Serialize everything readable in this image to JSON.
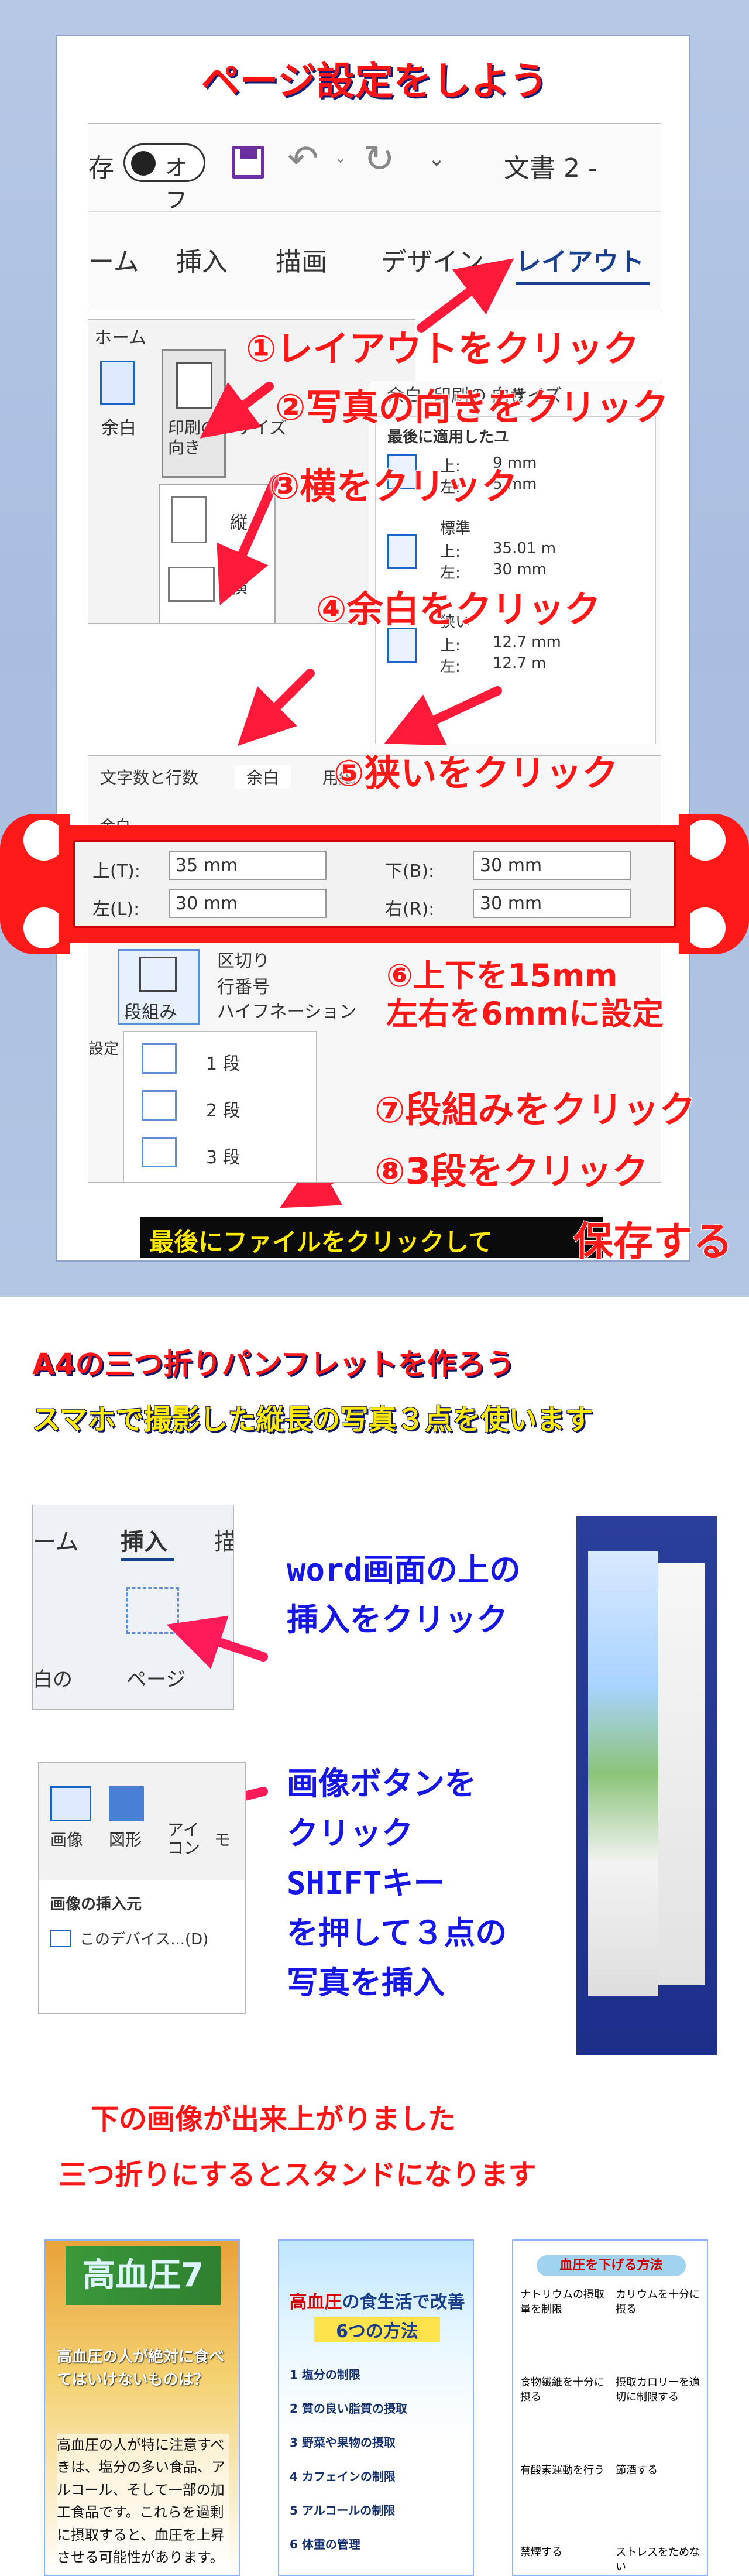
{
  "part1": {
    "title": "ページ設定をしよう",
    "toolbar": {
      "autosave_label": "存",
      "toggle_label": "オフ",
      "doc_name": "文書 2 -",
      "tabs": [
        "ーム",
        "挿入",
        "描画",
        "デザイン",
        "レイアウト"
      ]
    },
    "ribbon": {
      "home": "ホーム",
      "margins": "余白",
      "orientation": "印刷の\n向き",
      "size": "サイズ",
      "orientation_options": [
        "縦",
        "横"
      ],
      "margins_menu_title": "最後に適用したユ",
      "margins_menu_items": [
        {
          "k": "上:",
          "v": "9 mm"
        },
        {
          "k": "左:",
          "v": "5 mm"
        },
        {
          "k": "標準",
          "v": ""
        },
        {
          "k": "上:",
          "v": "35.01 m"
        },
        {
          "k": "左:",
          "v": "30 mm"
        },
        {
          "k": "狭い",
          "v": ""
        },
        {
          "k": "上:",
          "v": "12.7 mm"
        },
        {
          "k": "左:",
          "v": "12.7 m"
        }
      ]
    },
    "steps": [
      "①レイアウトをクリック",
      "②写真の向きをクリック",
      "③横をクリック",
      "④余白をクリック",
      "⑤狭いをクリック"
    ],
    "dialog": {
      "tabs": [
        "文字数と行数",
        "余白",
        "用紙"
      ],
      "section": "余白",
      "fields": [
        {
          "label": "上(T):",
          "value": "35 mm"
        },
        {
          "label": "下(B):",
          "value": "30 mm"
        },
        {
          "label": "左(L):",
          "value": "30 mm"
        },
        {
          "label": "右(R):",
          "value": "30 mm"
        }
      ]
    },
    "step6_line1": "⑥上下を15mm",
    "step6_line2": "左右を6mmに設定",
    "columns": {
      "button": "段組み",
      "kugiri": "区切り",
      "line_no": "行番号",
      "hyphen": "ハイフネーション",
      "setting": "設定",
      "options": [
        "1 段",
        "2 段",
        "3 段"
      ]
    },
    "step7": "⑦段組みをクリック",
    "step8": "⑧3段をクリック",
    "footer_prefix": "最後にファイルをクリックして",
    "footer_strong": "保存する"
  },
  "part2": {
    "title": "A4の三つ折りパンフレットを作ろう",
    "subtitle": "スマホで撮影した縦長の写真３点を使います",
    "shot1": {
      "tab_home": "ーム",
      "tab_insert": "挿入",
      "tab_draw": "描",
      "blank": "白の",
      "page": "ページ"
    },
    "inst1": [
      "word画面の上の",
      "挿入をクリック"
    ],
    "shot2": {
      "image": "画像",
      "shape": "図形",
      "icon": "アイ\nコン",
      "mo": "モ",
      "insert_from": "画像の挿入元",
      "this_device": "このデバイス...(D)"
    },
    "inst2": [
      "画像ボタンを",
      "クリック",
      "SHIFTキー",
      "を押して３点の",
      "写真を挿入"
    ],
    "result1": "下の画像が出来上がりました",
    "result2": "三つ折りにするとスタンドになります"
  },
  "panels": {
    "p1": {
      "title": "高血圧7",
      "heading": "高血圧の人が絶対に食べてはいけないものは？",
      "body": "高血圧の人が特に注意すべきは、塩分の多い食品、アルコール、そして一部の加工食品です。これらを過剰に摂取すると、血圧を上昇させる可能性があります。"
    },
    "p2": {
      "title_a": "高血圧",
      "title_b": "の食生活で改善する",
      "title_c": "6つの方法",
      "items": [
        "1 塩分の制限",
        "2 質の良い脂質の摂取",
        "3 野菜や果物の摂取",
        "4 カフェインの制限",
        "5 アルコールの制限",
        "6 体重の管理"
      ]
    },
    "p3": {
      "header": "血圧を下げる方法",
      "cells": [
        "ナトリウムの摂取量を制限",
        "カリウムを十分に摂る",
        "食物繊維を十分に摂る",
        "摂取カロリーを適切に制限する",
        "有酸素運動を行う",
        "節酒する",
        "禁煙する",
        "ストレスをためない"
      ]
    }
  },
  "colors": {
    "accent_red": "#ff1515",
    "accent_blue": "#1616e6",
    "highlight_yellow": "#ffea00"
  }
}
